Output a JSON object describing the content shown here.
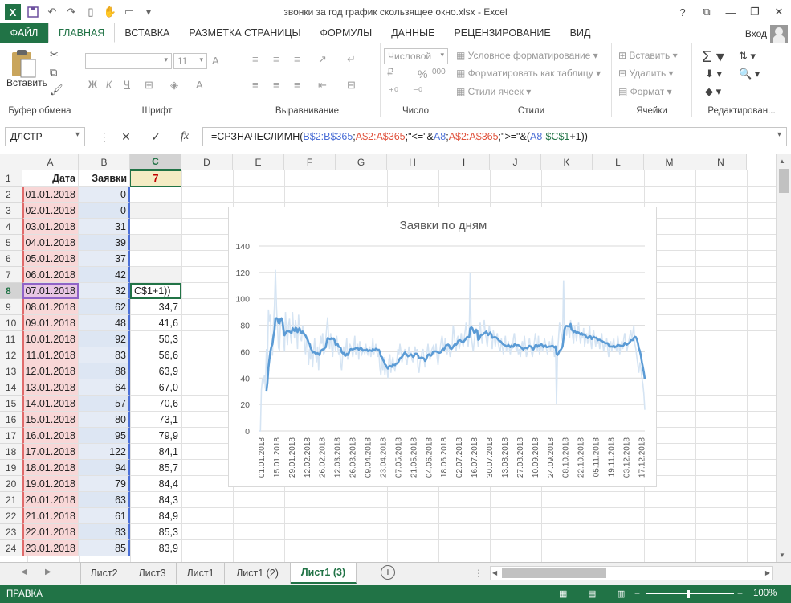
{
  "window": {
    "title": "звонки за год график скользящее окно.xlsx - Excel",
    "user": "Вход"
  },
  "tabs": [
    "ФАЙЛ",
    "ГЛАВНАЯ",
    "ВСТАВКА",
    "РАЗМЕТКА СТРАНИЦЫ",
    "ФОРМУЛЫ",
    "ДАННЫЕ",
    "РЕЦЕНЗИРОВАНИЕ",
    "ВИД"
  ],
  "ribbon": {
    "clipboard": {
      "paste": "Вставить",
      "label": "Буфер обмена"
    },
    "font": {
      "name": "",
      "size": "11",
      "bold": "Ж",
      "italic": "К",
      "underline": "Ч",
      "label": "Шрифт"
    },
    "alignment": {
      "label": "Выравнивание"
    },
    "number": {
      "format": "Числовой",
      "percent": "%",
      "thousands": "000",
      "label": "Число"
    },
    "styles": {
      "conditional": "Условное форматирование",
      "as_table": "Форматировать как таблицу",
      "cell_styles": "Стили ячеек",
      "label": "Стили"
    },
    "cells": {
      "insert": "Вставить",
      "delete": "Удалить",
      "format": "Формат",
      "label": "Ячейки"
    },
    "editing": {
      "label": "Редактирован..."
    }
  },
  "formula_bar": {
    "name_box": "ДЛСТР",
    "fx": "fx",
    "formula_parts": [
      {
        "t": "=СРЗНАЧЕСЛИМН(",
        "c": ""
      },
      {
        "t": "B$2:B$365",
        "c": "b"
      },
      {
        "t": ";",
        "c": ""
      },
      {
        "t": "A$2:A$365",
        "c": "r"
      },
      {
        "t": ";\"<=\"&",
        "c": ""
      },
      {
        "t": "A8",
        "c": "b"
      },
      {
        "t": ";",
        "c": ""
      },
      {
        "t": "A$2:A$365",
        "c": "r"
      },
      {
        "t": ";\">=\"&(",
        "c": ""
      },
      {
        "t": "A8",
        "c": "b"
      },
      {
        "t": "-",
        "c": ""
      },
      {
        "t": "$C$1",
        "c": "g"
      },
      {
        "t": "+1))",
        "c": ""
      }
    ]
  },
  "columns": [
    "A",
    "B",
    "C",
    "D",
    "E",
    "F",
    "G",
    "H",
    "I",
    "J",
    "K",
    "L",
    "M",
    "N"
  ],
  "rows": [
    "1",
    "2",
    "3",
    "4",
    "5",
    "6",
    "7",
    "8",
    "9",
    "10",
    "11",
    "12",
    "13",
    "14",
    "15",
    "16",
    "17",
    "18",
    "19",
    "20",
    "21",
    "22",
    "23",
    "24"
  ],
  "sheet": {
    "header": {
      "a": "Дата",
      "b": "Заявки",
      "c": "7"
    },
    "editing_text": "C$1+1))",
    "data": [
      [
        "01.01.2018",
        "0",
        ""
      ],
      [
        "02.01.2018",
        "0",
        ""
      ],
      [
        "03.01.2018",
        "31",
        ""
      ],
      [
        "04.01.2018",
        "39",
        ""
      ],
      [
        "05.01.2018",
        "37",
        ""
      ],
      [
        "06.01.2018",
        "42",
        ""
      ],
      [
        "07.01.2018",
        "32",
        ""
      ],
      [
        "08.01.2018",
        "62",
        "34,7"
      ],
      [
        "09.01.2018",
        "48",
        "41,6"
      ],
      [
        "10.01.2018",
        "92",
        "50,3"
      ],
      [
        "11.01.2018",
        "83",
        "56,6"
      ],
      [
        "12.01.2018",
        "88",
        "63,9"
      ],
      [
        "13.01.2018",
        "64",
        "67,0"
      ],
      [
        "14.01.2018",
        "57",
        "70,6"
      ],
      [
        "15.01.2018",
        "80",
        "73,1"
      ],
      [
        "16.01.2018",
        "95",
        "79,9"
      ],
      [
        "17.01.2018",
        "122",
        "84,1"
      ],
      [
        "18.01.2018",
        "94",
        "85,7"
      ],
      [
        "19.01.2018",
        "79",
        "84,4"
      ],
      [
        "20.01.2018",
        "63",
        "84,3"
      ],
      [
        "21.01.2018",
        "61",
        "84,9"
      ],
      [
        "22.01.2018",
        "83",
        "85,3"
      ],
      [
        "23.01.2018",
        "85",
        "83,9"
      ]
    ]
  },
  "chart_data": {
    "type": "line",
    "title": "Заявки по дням",
    "ylim": [
      0,
      140
    ],
    "yticks": [
      "0",
      "20",
      "40",
      "60",
      "80",
      "100",
      "120",
      "140"
    ],
    "xticks": [
      "01.01.2018",
      "15.01.2018",
      "29.01.2018",
      "12.02.2018",
      "26.02.2018",
      "12.03.2018",
      "26.03.2018",
      "09.04.2018",
      "23.04.2018",
      "07.05.2018",
      "21.05.2018",
      "04.06.2018",
      "18.06.2018",
      "02.07.2018",
      "16.07.2018",
      "30.07.2018",
      "13.08.2018",
      "27.08.2018",
      "10.09.2018",
      "24.09.2018",
      "08.10.2018",
      "22.10.2018",
      "05.11.2018",
      "19.11.2018",
      "03.12.2018",
      "17.12.2018"
    ],
    "series": [
      {
        "name": "",
        "color": "#d5e4f3",
        "values": [
          0,
          0,
          31,
          39,
          37,
          42,
          32,
          62,
          48,
          92,
          83,
          88,
          64,
          57,
          80,
          95,
          122,
          94,
          79,
          63,
          61,
          83,
          85,
          78,
          70,
          60,
          90,
          75,
          65,
          80,
          85,
          72,
          66,
          90,
          78,
          70,
          84,
          76,
          62,
          88,
          74,
          70,
          68,
          80,
          76,
          64,
          58,
          72,
          66,
          50,
          62,
          54,
          66,
          48,
          60,
          70,
          58,
          52,
          64,
          46,
          62,
          72,
          66,
          74,
          58,
          60,
          68,
          78,
          86,
          70,
          62,
          74,
          64,
          56,
          70,
          66,
          60,
          72,
          64,
          58,
          62,
          50,
          46,
          58,
          64,
          56,
          62,
          70,
          54,
          60,
          66,
          64,
          62,
          56,
          64,
          72,
          58,
          60,
          66,
          54,
          68,
          62,
          58,
          60,
          62,
          58,
          66,
          60,
          58,
          62,
          64,
          56,
          60,
          70,
          58,
          62,
          66,
          60,
          56,
          60,
          48,
          42,
          54,
          46,
          56,
          42,
          50,
          48,
          40,
          54,
          58,
          44,
          52,
          56,
          48,
          46,
          50,
          54,
          62,
          58,
          66,
          60,
          52,
          56,
          60,
          62,
          54,
          50,
          58,
          64,
          56,
          60,
          54,
          52,
          60,
          64,
          58,
          62,
          48,
          44,
          52,
          56,
          60,
          62,
          54,
          48,
          56,
          60,
          66,
          58,
          54,
          60,
          62,
          64,
          58,
          60,
          66,
          56,
          50,
          58,
          62,
          68,
          72,
          66,
          60,
          70,
          64,
          58,
          66,
          62,
          56,
          60,
          64,
          80,
          74,
          66,
          60,
          70,
          72,
          62,
          66,
          74,
          68,
          64,
          70,
          76,
          82,
          70,
          64,
          74,
          120,
          72,
          66,
          60,
          68,
          74,
          78,
          70,
          64,
          76,
          82,
          72,
          66,
          78,
          84,
          74,
          70,
          64,
          72,
          80,
          74,
          68,
          62,
          76,
          72,
          64,
          70,
          74,
          66,
          62,
          60,
          70,
          64,
          58,
          66,
          72,
          60,
          64,
          68,
          62,
          58,
          66,
          62,
          70,
          74,
          66,
          60,
          64,
          58,
          62,
          56,
          64,
          68,
          60,
          72,
          64,
          56,
          60,
          66,
          70,
          64,
          60,
          56,
          62,
          68,
          74,
          66,
          60,
          72,
          58,
          62,
          66,
          60,
          64,
          70,
          66,
          62,
          58,
          64,
          68,
          60,
          66,
          72,
          62,
          56,
          64,
          20,
          60,
          70,
          82,
          76,
          72,
          68,
          114,
          74,
          78,
          72,
          80,
          76,
          70,
          84,
          78,
          72,
          66,
          80,
          74,
          68,
          76,
          82,
          72,
          66,
          74,
          70,
          78,
          64,
          70,
          74,
          66,
          72,
          80,
          68,
          62,
          72,
          76,
          70,
          64,
          72,
          66,
          70,
          62,
          68,
          74,
          66,
          60,
          68,
          64,
          70,
          62,
          56,
          64,
          68,
          60,
          66,
          70,
          62,
          64,
          60,
          72,
          66,
          58,
          64,
          68,
          62,
          70,
          74,
          66,
          60,
          64,
          68,
          72,
          76,
          70,
          74,
          80,
          66,
          62,
          56,
          50,
          44,
          52,
          48,
          40,
          36,
          28,
          16
        ]
      },
      {
        "name": "",
        "color": "#5b9bd5",
        "values": []
      }
    ]
  },
  "sheet_tabs": [
    "Лист2",
    "Лист3",
    "Лист1",
    "Лист1 (2)",
    "Лист1 (3)"
  ],
  "active_sheet": "Лист1 (3)",
  "status": {
    "mode": "ПРАВКА",
    "zoom": "100%"
  }
}
